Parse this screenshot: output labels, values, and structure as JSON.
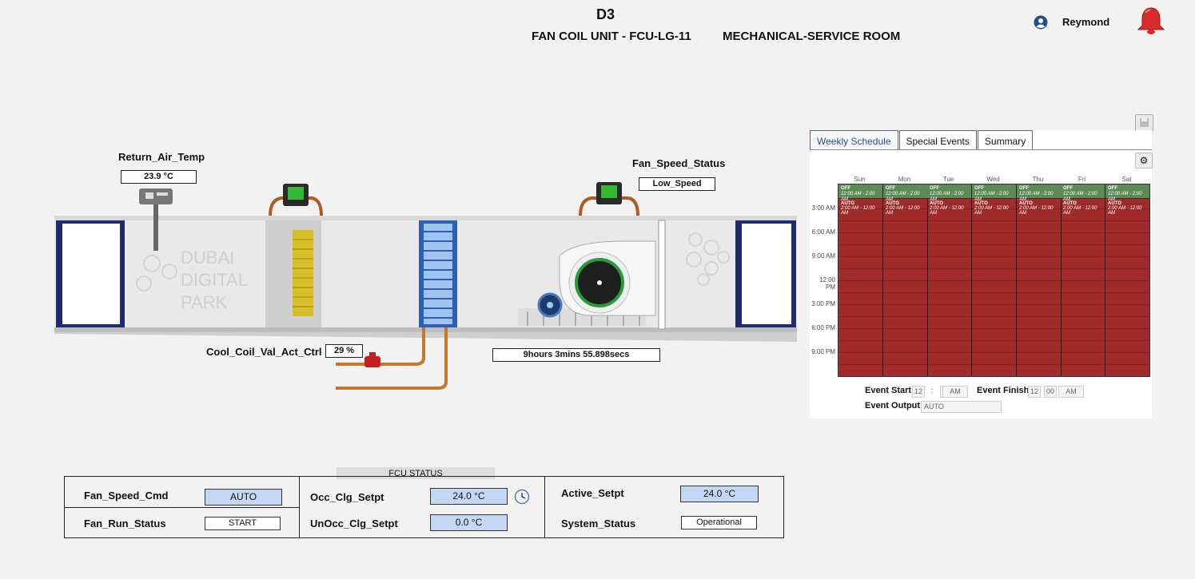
{
  "header": {
    "title": "D3",
    "unit_name": "FAN COIL UNIT - FCU-LG-11",
    "location": "MECHANICAL-SERVICE ROOM",
    "user": "Reymond",
    "icons": {
      "user": "user-circle-icon",
      "alarm": "alarm-bell-icon"
    },
    "colors": {
      "alarm": "#d62b2b"
    }
  },
  "diagram": {
    "return_air_temp": {
      "label": "Return_Air_Temp",
      "value": "23.9 °C"
    },
    "fan_speed_status": {
      "label": "Fan_Speed_Status",
      "value": "Low_Speed"
    },
    "cool_coil_valve": {
      "label": "Cool_Coil_Val_Act_Ctrl",
      "value": "29 %"
    },
    "run_hours": "9hours 3mins 55.898secs",
    "watermark": [
      "DUBAI",
      "DIGITAL",
      "PARK"
    ]
  },
  "schedule": {
    "tabs": [
      "Weekly Schedule",
      "Special Events",
      "Summary"
    ],
    "active_tab": "Weekly Schedule",
    "days": [
      "Sun",
      "Mon",
      "Tue",
      "Wed",
      "Thu",
      "Fri",
      "Sat"
    ],
    "time_labels": [
      "3:00 AM",
      "6:00 AM",
      "9:00 AM",
      "12:00 PM",
      "3:00 PM",
      "6:00 PM",
      "9:00 PM"
    ],
    "off_block": {
      "state": "OFF",
      "range": "12:00 AM - 2:00 AM"
    },
    "auto_block": {
      "state": "AUTO",
      "range": "2:00 AM - 12:00 AM"
    },
    "colors": {
      "off": "#5d8b55",
      "auto": "#a12a2a"
    },
    "event_start_label": "Event Start",
    "event_finish_label": "Event Finish",
    "event_output_label": "Event Output",
    "event_start": {
      "hour": "12",
      "minute": "00",
      "ampm": "AM"
    },
    "event_finish": {
      "hour": "12",
      "minute": "00",
      "ampm": "AM"
    },
    "event_output": "AUTO"
  },
  "status": {
    "title": "FCU STATUS",
    "fan_speed_cmd": {
      "label": "Fan_Speed_Cmd",
      "value": "AUTO"
    },
    "fan_run_status": {
      "label": "Fan_Run_Status",
      "value": "START"
    },
    "occ_clg_setpt": {
      "label": "Occ_Clg_Setpt",
      "value": "24.0 °C"
    },
    "unocc_clg_setpt": {
      "label": "UnOcc_Clg_Setpt",
      "value": "0.0 °C"
    },
    "active_setpt": {
      "label": "Active_Setpt",
      "value": "24.0 °C"
    },
    "system_status": {
      "label": "System_Status",
      "value": "Operational"
    }
  }
}
